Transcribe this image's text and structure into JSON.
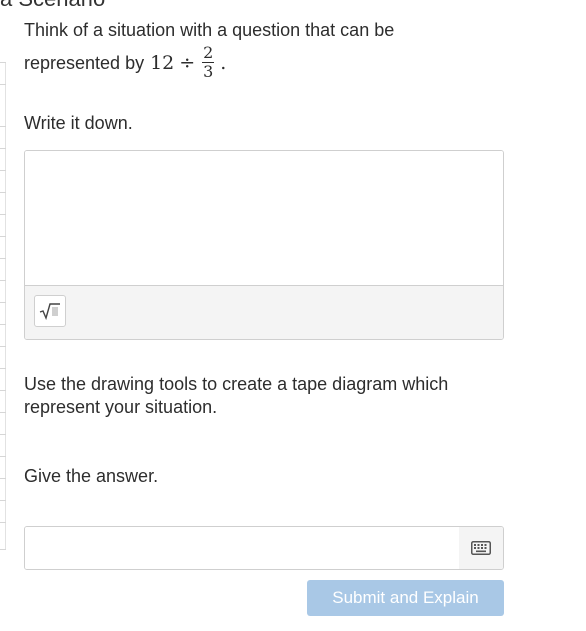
{
  "header": {
    "cut_title": "a Scenario"
  },
  "question": {
    "prompt_line1": "Think of a situation with a question that can be",
    "prompt_line2": "represented by",
    "expression": {
      "whole": "12",
      "operator": "÷",
      "numerator": "2",
      "denominator": "3"
    },
    "period": "."
  },
  "write_section": {
    "label": "Write it down.",
    "text_value": "",
    "math_button_icon": "square-root-icon"
  },
  "drawing_section": {
    "label": "Use the drawing tools to create a tape diagram which represent your situation."
  },
  "answer_section": {
    "label": "Give the answer.",
    "input_value": "",
    "keyboard_button_icon": "keyboard-icon"
  },
  "submit": {
    "label": "Submit and Explain",
    "enabled": false,
    "color": "#a9c8e6"
  }
}
